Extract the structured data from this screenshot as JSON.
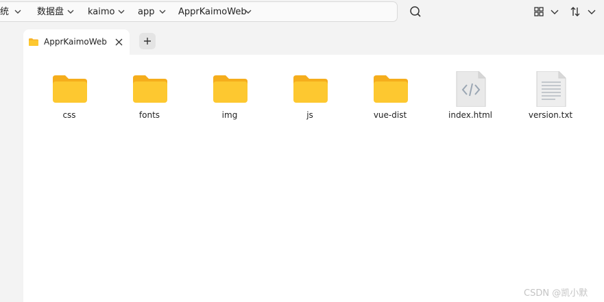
{
  "breadcrumbs": [
    {
      "label": "系统"
    },
    {
      "label": "数据盘"
    },
    {
      "label": "kaimo"
    },
    {
      "label": "app"
    },
    {
      "label": "ApprKaimoWeb"
    }
  ],
  "toolbar_icons": [
    "search-icon",
    "grid-view-icon",
    "chevron-down-icon",
    "sort-icon",
    "chevron-down-icon"
  ],
  "tab": {
    "label": "ApprKaimoWeb"
  },
  "files": [
    {
      "name": "css",
      "type": "folder"
    },
    {
      "name": "fonts",
      "type": "folder"
    },
    {
      "name": "img",
      "type": "folder"
    },
    {
      "name": "js",
      "type": "folder"
    },
    {
      "name": "vue-dist",
      "type": "folder"
    },
    {
      "name": "index.html",
      "type": "html"
    },
    {
      "name": "version.txt",
      "type": "text"
    }
  ],
  "colors": {
    "folder": "#fdc830",
    "folder_dark": "#f5ad1c",
    "accent": "#3c8ce7"
  },
  "watermark": "CSDN @凯小默"
}
